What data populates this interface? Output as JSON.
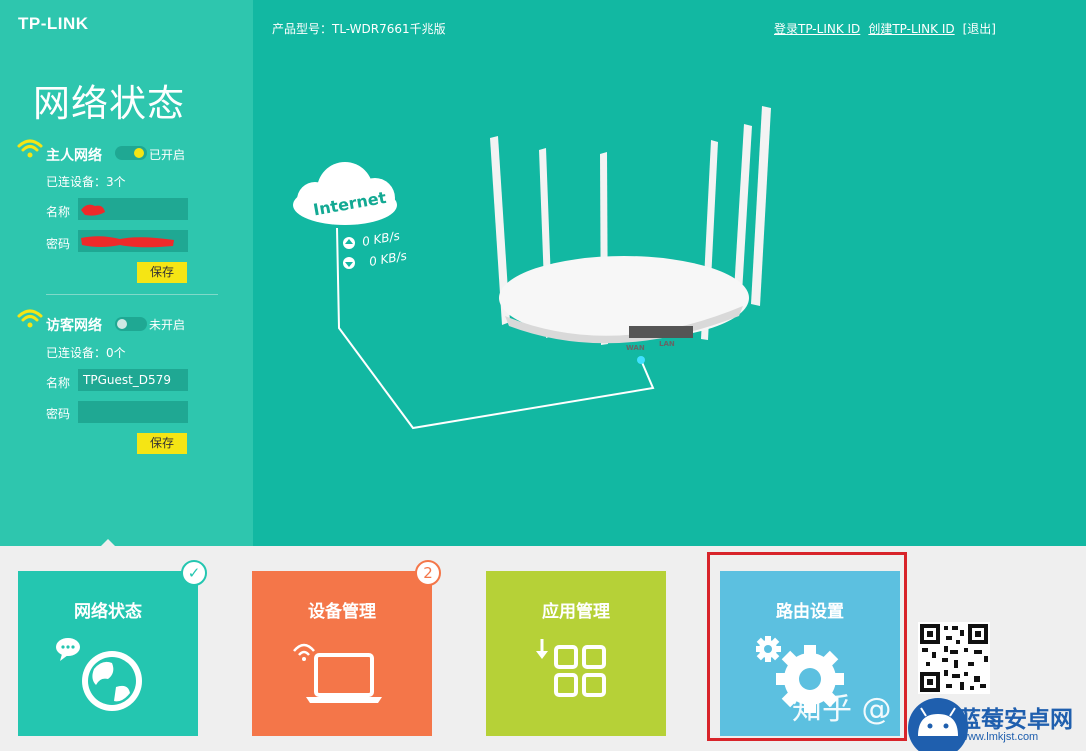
{
  "brand": {
    "logo_text": "TP-LINK"
  },
  "header": {
    "model_text": "产品型号：TL-WDR7661千兆版",
    "login_link": "登录TP-LINK ID",
    "create_link": "创建TP-LINK ID",
    "logout_link": "[退出]"
  },
  "sidebar": {
    "title": "网络状态",
    "main_network": {
      "title": "主人网络",
      "status": "已开启",
      "connected": "已连设备：3个",
      "name_label": "名称",
      "name_value": "",
      "password_label": "密码",
      "password_value": "",
      "save_label": "保存"
    },
    "guest_network": {
      "title": "访客网络",
      "status": "未开启",
      "connected": "已连设备：0个",
      "name_label": "名称",
      "name_value": "TPGuest_D579",
      "password_label": "密码",
      "password_value": "",
      "save_label": "保存"
    }
  },
  "diagram": {
    "cloud_label": "Internet",
    "upload_speed": "0 KB/s",
    "download_speed": "0 KB/s",
    "wan_label": "WAN",
    "lan_label": "LAN"
  },
  "tiles": [
    {
      "title": "网络状态",
      "color": "#24c6b0",
      "badge": "✓"
    },
    {
      "title": "设备管理",
      "color": "#f47649",
      "badge": "2"
    },
    {
      "title": "应用管理",
      "color": "#b6d137",
      "badge": ""
    },
    {
      "title": "路由设置",
      "color": "#5cc0e0",
      "badge": ""
    }
  ],
  "watermark": {
    "text": "知乎 @"
  },
  "site_brand": {
    "name": "蓝莓安卓网",
    "url": "www.lmkjst.com"
  },
  "colors": {
    "accent": "#12b8a2",
    "sidebar": "#2ec6ae",
    "save": "#f5e514",
    "highlight": "#d8242a"
  }
}
